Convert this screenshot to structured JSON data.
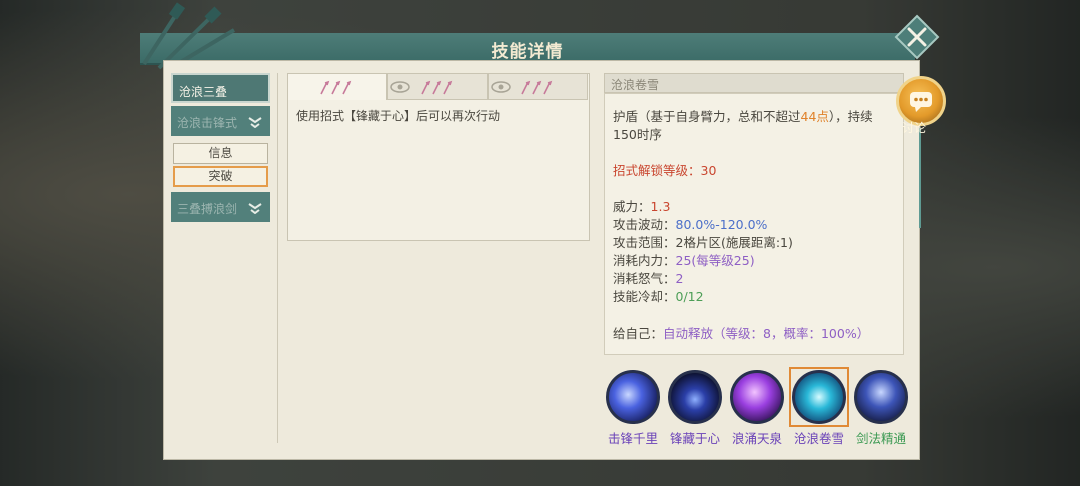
{
  "window": {
    "title": "技能详情"
  },
  "left_tabs": [
    {
      "label": "沧浪三叠",
      "state": "active"
    },
    {
      "label": "沧浪击锋式",
      "state": "dim"
    },
    {
      "label": "三叠搏浪剑",
      "state": "dim"
    }
  ],
  "sub_buttons": [
    {
      "label": "信息"
    },
    {
      "label": "突破"
    }
  ],
  "middle": {
    "description": "使用招式【锋藏于心】后可以再次行动"
  },
  "detail": {
    "skill_name": "沧浪卷雪",
    "shield_line1_prefix": "护盾（基于自身臂力，总和不超过",
    "shield_value": "44点",
    "shield_line1_suffix": "），持续",
    "shield_line2": "150时序",
    "unlock_label": "招式解锁等级：",
    "unlock_value": "30",
    "stats": [
      {
        "label": "威力：",
        "value": "1.3",
        "color": "#c9462f"
      },
      {
        "label": "攻击波动：",
        "value": "80.0%-120.0%",
        "color": "#4c6fc9"
      },
      {
        "label": "攻击范围：",
        "value": "2格片区(施展距离:1)",
        "color": "#4a473f"
      },
      {
        "label": "消耗内力：",
        "value": "25(每等级25)",
        "color": "#8e5fc4"
      },
      {
        "label": "消耗怒气：",
        "value": "2",
        "color": "#8e5fc4"
      },
      {
        "label": "技能冷却：",
        "value": "0/12",
        "color": "#4d9e57"
      }
    ],
    "self_label": "给自己：",
    "self_value": "自动释放（等级：8，概率：100%）"
  },
  "skills": [
    {
      "name": "击锋千里",
      "icon": "swirl-blade-icon",
      "color": "#3b5bd6"
    },
    {
      "name": "锋藏于心",
      "icon": "dark-wave-icon",
      "color": "#24306a"
    },
    {
      "name": "浪涌天泉",
      "icon": "purple-arc-icon",
      "color": "#8a3fd1"
    },
    {
      "name": "沧浪卷雪",
      "icon": "cyan-vortex-icon",
      "color": "#1aa6c9"
    },
    {
      "name": "剑法精通",
      "icon": "sword-mastery-icon",
      "color": "#2f3f7a"
    }
  ],
  "comment_button": {
    "label": "讨论"
  },
  "colors": {
    "teal": "#4e7d78",
    "accent_orange": "#e0822a"
  }
}
